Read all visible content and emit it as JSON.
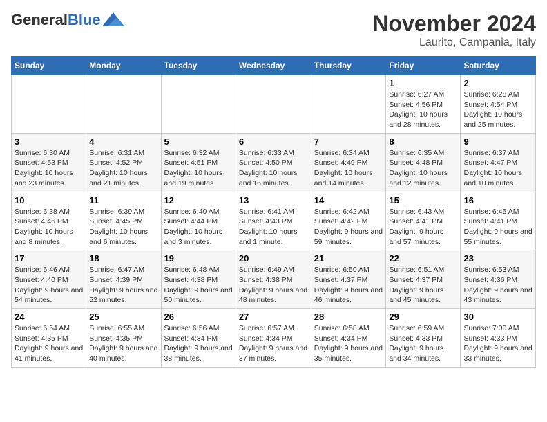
{
  "header": {
    "logo_general": "General",
    "logo_blue": "Blue",
    "title": "November 2024",
    "subtitle": "Laurito, Campania, Italy"
  },
  "weekdays": [
    "Sunday",
    "Monday",
    "Tuesday",
    "Wednesday",
    "Thursday",
    "Friday",
    "Saturday"
  ],
  "weeks": [
    [
      {
        "day": "",
        "info": ""
      },
      {
        "day": "",
        "info": ""
      },
      {
        "day": "",
        "info": ""
      },
      {
        "day": "",
        "info": ""
      },
      {
        "day": "",
        "info": ""
      },
      {
        "day": "1",
        "info": "Sunrise: 6:27 AM\nSunset: 4:56 PM\nDaylight: 10 hours and 28 minutes."
      },
      {
        "day": "2",
        "info": "Sunrise: 6:28 AM\nSunset: 4:54 PM\nDaylight: 10 hours and 25 minutes."
      }
    ],
    [
      {
        "day": "3",
        "info": "Sunrise: 6:30 AM\nSunset: 4:53 PM\nDaylight: 10 hours and 23 minutes."
      },
      {
        "day": "4",
        "info": "Sunrise: 6:31 AM\nSunset: 4:52 PM\nDaylight: 10 hours and 21 minutes."
      },
      {
        "day": "5",
        "info": "Sunrise: 6:32 AM\nSunset: 4:51 PM\nDaylight: 10 hours and 19 minutes."
      },
      {
        "day": "6",
        "info": "Sunrise: 6:33 AM\nSunset: 4:50 PM\nDaylight: 10 hours and 16 minutes."
      },
      {
        "day": "7",
        "info": "Sunrise: 6:34 AM\nSunset: 4:49 PM\nDaylight: 10 hours and 14 minutes."
      },
      {
        "day": "8",
        "info": "Sunrise: 6:35 AM\nSunset: 4:48 PM\nDaylight: 10 hours and 12 minutes."
      },
      {
        "day": "9",
        "info": "Sunrise: 6:37 AM\nSunset: 4:47 PM\nDaylight: 10 hours and 10 minutes."
      }
    ],
    [
      {
        "day": "10",
        "info": "Sunrise: 6:38 AM\nSunset: 4:46 PM\nDaylight: 10 hours and 8 minutes."
      },
      {
        "day": "11",
        "info": "Sunrise: 6:39 AM\nSunset: 4:45 PM\nDaylight: 10 hours and 6 minutes."
      },
      {
        "day": "12",
        "info": "Sunrise: 6:40 AM\nSunset: 4:44 PM\nDaylight: 10 hours and 3 minutes."
      },
      {
        "day": "13",
        "info": "Sunrise: 6:41 AM\nSunset: 4:43 PM\nDaylight: 10 hours and 1 minute."
      },
      {
        "day": "14",
        "info": "Sunrise: 6:42 AM\nSunset: 4:42 PM\nDaylight: 9 hours and 59 minutes."
      },
      {
        "day": "15",
        "info": "Sunrise: 6:43 AM\nSunset: 4:41 PM\nDaylight: 9 hours and 57 minutes."
      },
      {
        "day": "16",
        "info": "Sunrise: 6:45 AM\nSunset: 4:41 PM\nDaylight: 9 hours and 55 minutes."
      }
    ],
    [
      {
        "day": "17",
        "info": "Sunrise: 6:46 AM\nSunset: 4:40 PM\nDaylight: 9 hours and 54 minutes."
      },
      {
        "day": "18",
        "info": "Sunrise: 6:47 AM\nSunset: 4:39 PM\nDaylight: 9 hours and 52 minutes."
      },
      {
        "day": "19",
        "info": "Sunrise: 6:48 AM\nSunset: 4:38 PM\nDaylight: 9 hours and 50 minutes."
      },
      {
        "day": "20",
        "info": "Sunrise: 6:49 AM\nSunset: 4:38 PM\nDaylight: 9 hours and 48 minutes."
      },
      {
        "day": "21",
        "info": "Sunrise: 6:50 AM\nSunset: 4:37 PM\nDaylight: 9 hours and 46 minutes."
      },
      {
        "day": "22",
        "info": "Sunrise: 6:51 AM\nSunset: 4:37 PM\nDaylight: 9 hours and 45 minutes."
      },
      {
        "day": "23",
        "info": "Sunrise: 6:53 AM\nSunset: 4:36 PM\nDaylight: 9 hours and 43 minutes."
      }
    ],
    [
      {
        "day": "24",
        "info": "Sunrise: 6:54 AM\nSunset: 4:35 PM\nDaylight: 9 hours and 41 minutes."
      },
      {
        "day": "25",
        "info": "Sunrise: 6:55 AM\nSunset: 4:35 PM\nDaylight: 9 hours and 40 minutes."
      },
      {
        "day": "26",
        "info": "Sunrise: 6:56 AM\nSunset: 4:34 PM\nDaylight: 9 hours and 38 minutes."
      },
      {
        "day": "27",
        "info": "Sunrise: 6:57 AM\nSunset: 4:34 PM\nDaylight: 9 hours and 37 minutes."
      },
      {
        "day": "28",
        "info": "Sunrise: 6:58 AM\nSunset: 4:34 PM\nDaylight: 9 hours and 35 minutes."
      },
      {
        "day": "29",
        "info": "Sunrise: 6:59 AM\nSunset: 4:33 PM\nDaylight: 9 hours and 34 minutes."
      },
      {
        "day": "30",
        "info": "Sunrise: 7:00 AM\nSunset: 4:33 PM\nDaylight: 9 hours and 33 minutes."
      }
    ]
  ]
}
